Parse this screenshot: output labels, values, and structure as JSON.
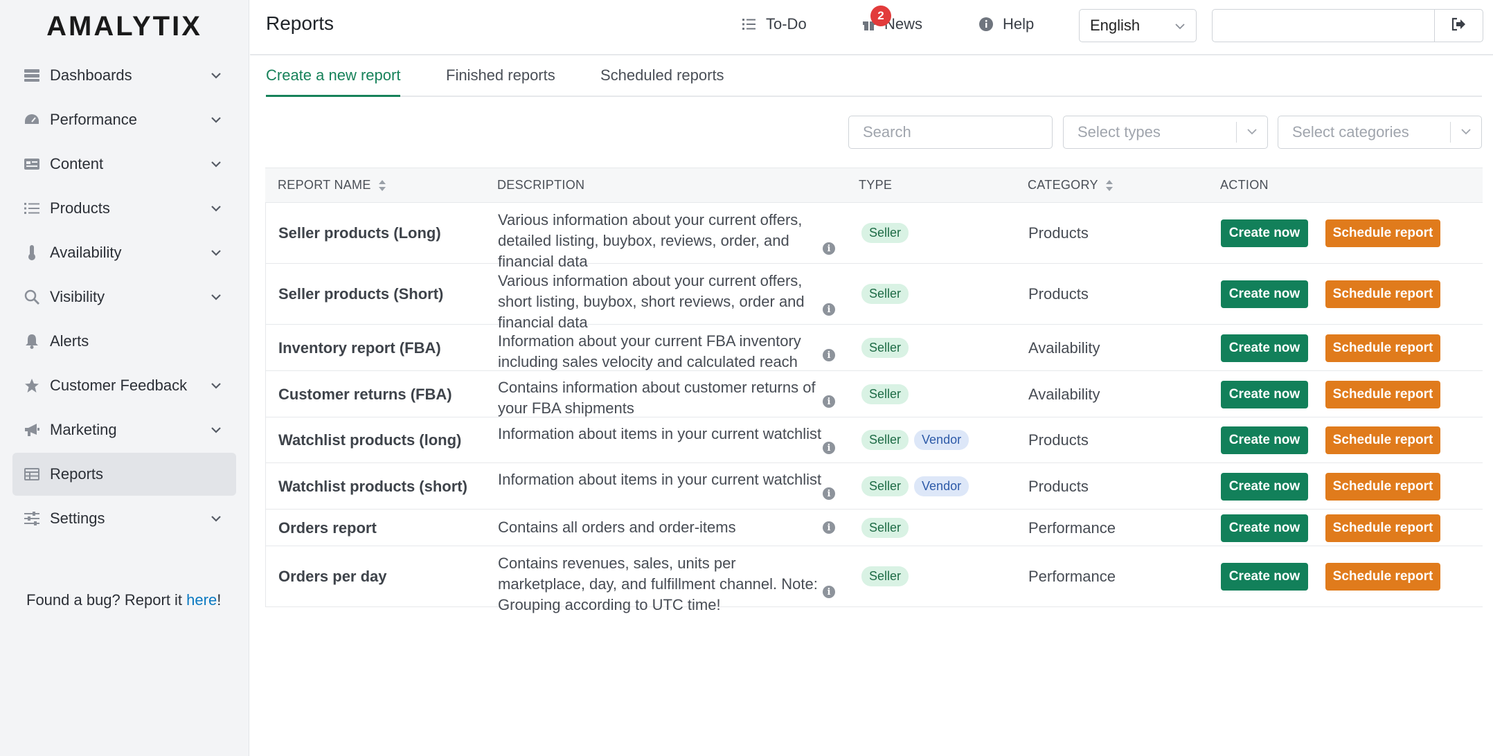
{
  "app": {
    "logo": "AMALYTIX"
  },
  "sidebar": {
    "items": [
      {
        "label": "Dashboards",
        "icon": "dashboard-icon",
        "expandable": true
      },
      {
        "label": "Performance",
        "icon": "gauge-icon",
        "expandable": true
      },
      {
        "label": "Content",
        "icon": "content-card-icon",
        "expandable": true
      },
      {
        "label": "Products",
        "icon": "list-icon",
        "expandable": true
      },
      {
        "label": "Availability",
        "icon": "thermometer-icon",
        "expandable": true
      },
      {
        "label": "Visibility",
        "icon": "search-icon",
        "expandable": true
      },
      {
        "label": "Alerts",
        "icon": "bell-icon",
        "expandable": false
      },
      {
        "label": "Customer Feedback",
        "icon": "star-icon",
        "expandable": true
      },
      {
        "label": "Marketing",
        "icon": "megaphone-icon",
        "expandable": true
      },
      {
        "label": "Reports",
        "icon": "table-icon",
        "expandable": false,
        "active": true
      },
      {
        "label": "Settings",
        "icon": "sliders-icon",
        "expandable": true
      }
    ],
    "bug_text": "Found a bug? Report it ",
    "bug_link": "here",
    "bug_suffix": "!"
  },
  "header": {
    "title": "Reports",
    "todo_label": "To-Do",
    "news_label": "News",
    "news_badge": "2",
    "help_label": "Help",
    "language": "English"
  },
  "tabs": [
    {
      "label": "Create a new report",
      "active": true
    },
    {
      "label": "Finished reports",
      "active": false
    },
    {
      "label": "Scheduled reports",
      "active": false
    }
  ],
  "filters": {
    "search_placeholder": "Search",
    "types_placeholder": "Select types",
    "categories_placeholder": "Select categories"
  },
  "table": {
    "headers": {
      "name": "REPORT NAME",
      "description": "DESCRIPTION",
      "type": "TYPE",
      "category": "CATEGORY",
      "action": "ACTION"
    },
    "create_label": "Create now",
    "schedule_label": "Schedule report",
    "rows": [
      {
        "name": "Seller products (Long)",
        "description": "Various information about your current offers, detailed listing, buybox, reviews, order, and financial data",
        "types": [
          "Seller"
        ],
        "category": "Products"
      },
      {
        "name": "Seller products (Short)",
        "description": "Various information about your current offers, short listing, buybox, short reviews, order and financial data",
        "types": [
          "Seller"
        ],
        "category": "Products"
      },
      {
        "name": "Inventory report (FBA)",
        "description": "Information about your current FBA inventory including sales velocity and calculated reach",
        "types": [
          "Seller"
        ],
        "category": "Availability"
      },
      {
        "name": "Customer returns (FBA)",
        "description": "Contains information about customer returns of your FBA shipments",
        "types": [
          "Seller"
        ],
        "category": "Availability"
      },
      {
        "name": "Watchlist products (long)",
        "description": "Information about items in your current watchlist",
        "types": [
          "Seller",
          "Vendor"
        ],
        "category": "Products"
      },
      {
        "name": "Watchlist products (short)",
        "description": "Information about items in your current watchlist",
        "types": [
          "Seller",
          "Vendor"
        ],
        "category": "Products"
      },
      {
        "name": "Orders report",
        "description": "Contains all orders and order-items",
        "types": [
          "Seller"
        ],
        "category": "Performance"
      },
      {
        "name": "Orders per day",
        "description": "Contains revenues, sales, units per marketplace, day, and fulfillment channel. Note: Grouping according to UTC time!",
        "types": [
          "Seller"
        ],
        "category": "Performance"
      }
    ]
  },
  "colors": {
    "accent_green": "#12805a",
    "accent_orange": "#e07b1c",
    "active_tab": "#17825a",
    "badge_red": "#e23b3b",
    "link_blue": "#0b79c1"
  }
}
